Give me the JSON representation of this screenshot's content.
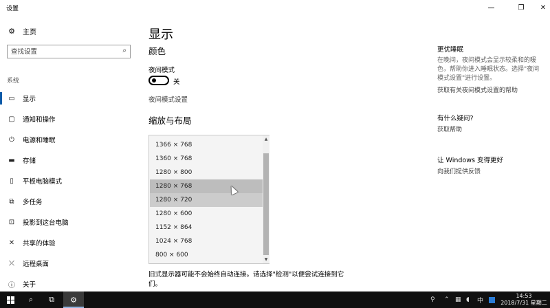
{
  "window": {
    "title": "设置",
    "min_glyph": "—",
    "max_glyph": "❐",
    "close_glyph": "✕"
  },
  "sidebar": {
    "home_icon": "gear-icon",
    "home_label": "主页",
    "search_placeholder": "查找设置",
    "section_label": "系统",
    "items": [
      {
        "label": "显示",
        "icon": "monitor-icon",
        "glyph": "▭",
        "active": true
      },
      {
        "label": "通知和操作",
        "icon": "notification-icon",
        "glyph": "▢"
      },
      {
        "label": "电源和睡眠",
        "icon": "power-icon",
        "glyph": "⏻"
      },
      {
        "label": "存储",
        "icon": "storage-icon",
        "glyph": "▬"
      },
      {
        "label": "平板电脑模式",
        "icon": "tablet-icon",
        "glyph": "▯"
      },
      {
        "label": "多任务",
        "icon": "multitask-icon",
        "glyph": "⧉"
      },
      {
        "label": "投影到这台电脑",
        "icon": "project-icon",
        "glyph": "⊡"
      },
      {
        "label": "共享的体验",
        "icon": "share-icon",
        "glyph": "✕"
      },
      {
        "label": "远程桌面",
        "icon": "remote-icon",
        "glyph": "⤫"
      },
      {
        "label": "关于",
        "icon": "info-icon",
        "glyph": "ⓘ"
      }
    ]
  },
  "main": {
    "title": "显示",
    "color_heading": "颜色",
    "night_mode_label": "夜间模式",
    "night_mode_state": "关",
    "night_mode_on": false,
    "night_mode_settings_link": "夜间模式设置",
    "scale_heading": "缩放与布局",
    "resolutions": [
      "1366 × 768",
      "1360 × 768",
      "1280 × 800",
      "1280 × 768",
      "1280 × 720",
      "1280 × 600",
      "1152 × 864",
      "1024 × 768",
      "800 × 600"
    ],
    "hovered_index": 3,
    "selected_index": 4,
    "note": "旧式显示器可能不会始终自动连接。请选择\"检测\"以便尝试连接到它们。"
  },
  "right": {
    "better_sleep": {
      "heading": "更优睡眠",
      "text": "在晚间，夜间模式会显示较柔和的暖色，帮助你进入睡眠状态。选择\"夜间模式设置\"进行设置。",
      "link": "获取有关夜间模式设置的帮助"
    },
    "questions": {
      "heading": "有什么疑问?",
      "link": "获取帮助"
    },
    "feedback": {
      "heading": "让 Windows 变得更好",
      "link": "向我们提供反馈"
    }
  },
  "taskbar": {
    "time": "14:53",
    "date": "2018/7/31 星期二",
    "ime": "中",
    "colors": {
      "bg": "#101010",
      "accent": "#2a7bd5"
    }
  }
}
